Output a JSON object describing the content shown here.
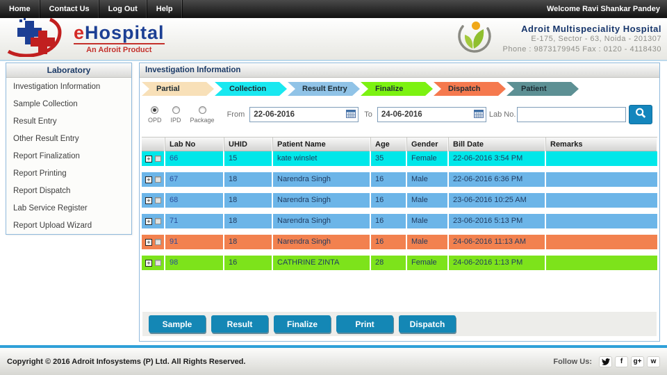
{
  "nav": {
    "items": [
      "Home",
      "Contact Us",
      "Log Out",
      "Help"
    ],
    "welcome": "Welcome Ravi Shankar Pandey"
  },
  "header": {
    "brand": {
      "first_letter": "e",
      "rest": "Hospital",
      "tagline": "An Adroit Product"
    },
    "hospital": {
      "name": "Adroit Multispeciality Hospital",
      "address": "E-175, Sector - 63, Noida - 201307",
      "phone": "Phone : 9873179945 Fax : 0120 - 4118430"
    }
  },
  "sidebar": {
    "title": "Laboratory",
    "items": [
      "Investigation Information",
      "Sample Collection",
      "Result Entry",
      "Other Result Entry",
      "Report Finalization",
      "Report Printing",
      "Report Dispatch",
      "Lab Service Register",
      "Report Upload Wizard"
    ]
  },
  "main": {
    "title": "Investigation Information",
    "steps": [
      {
        "label": "Partial",
        "color": "#F8E0B8"
      },
      {
        "label": "Collection",
        "color": "#19E8F0"
      },
      {
        "label": "Result Entry",
        "color": "#90C3E7"
      },
      {
        "label": "Finalize",
        "color": "#7CF211"
      },
      {
        "label": "Dispatch",
        "color": "#F5794E"
      },
      {
        "label": "Patient",
        "color": "#5D9094"
      }
    ],
    "filters": {
      "radios": [
        {
          "label": "OPD",
          "checked": true
        },
        {
          "label": "IPD",
          "checked": false
        },
        {
          "label": "Package",
          "checked": false
        }
      ],
      "from_label": "From",
      "from_value": "22-06-2016",
      "to_label": "To",
      "to_value": "24-06-2016",
      "labno_label": "Lab No.",
      "labno_value": ""
    },
    "table": {
      "columns": [
        "Lab No",
        "UHID",
        "Patient Name",
        "Age",
        "Gender",
        "Bill Date",
        "Remarks"
      ],
      "rows": [
        {
          "lab_no": "66",
          "uhid": "15",
          "patient": "kate winslet",
          "age": "35",
          "gender": "Female",
          "bill_date": "22-06-2016 3:54 PM",
          "remarks": "",
          "color": "#00E7E9"
        },
        {
          "lab_no": "67",
          "uhid": "18",
          "patient": "Narendra Singh",
          "age": "16",
          "gender": "Male",
          "bill_date": "22-06-2016 6:36 PM",
          "remarks": "",
          "color": "#6CB5E8"
        },
        {
          "lab_no": "68",
          "uhid": "18",
          "patient": "Narendra Singh",
          "age": "16",
          "gender": "Male",
          "bill_date": "23-06-2016 10:25 AM",
          "remarks": "",
          "color": "#6CB5E8"
        },
        {
          "lab_no": "71",
          "uhid": "18",
          "patient": "Narendra Singh",
          "age": "16",
          "gender": "Male",
          "bill_date": "23-06-2016 5:13 PM",
          "remarks": "",
          "color": "#6CB5E8"
        },
        {
          "lab_no": "91",
          "uhid": "18",
          "patient": "Narendra Singh",
          "age": "16",
          "gender": "Male",
          "bill_date": "24-06-2016 11:13 AM",
          "remarks": "",
          "color": "#F2814F"
        },
        {
          "lab_no": "98",
          "uhid": "16",
          "patient": "CATHRINE ZINTA",
          "age": "28",
          "gender": "Female",
          "bill_date": "24-06-2016 1:13 PM",
          "remarks": "",
          "color": "#7DE31B"
        }
      ]
    },
    "actions": [
      "Sample",
      "Result",
      "Finalize",
      "Print",
      "Dispatch"
    ]
  },
  "footer": {
    "copyright": "Copyright © 2016 Adroit Infosystems (P) Ltd. All Rights Reserved.",
    "follow": "Follow Us:",
    "social_glyphs": {
      "facebook": "f",
      "google_plus": "g+",
      "wordpress": "w"
    }
  },
  "colors": {
    "accent_blue": "#1487b5",
    "separator_blue": "#2fa0d8",
    "navy_text": "#1b3a66"
  }
}
